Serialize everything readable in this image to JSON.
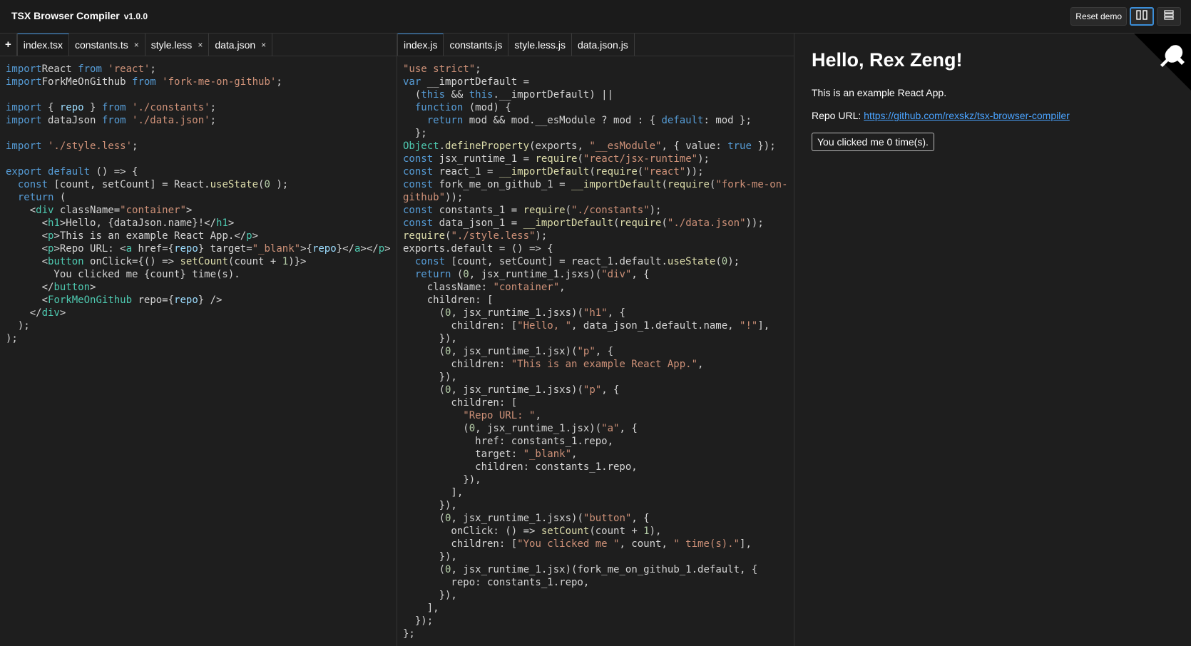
{
  "app": {
    "title": "TSX Browser Compiler",
    "version": "v1.0.0"
  },
  "toolbar": {
    "reset_label": "Reset demo"
  },
  "source_tabs": [
    {
      "label": "index.tsx",
      "close": "×"
    },
    {
      "label": "constants.ts",
      "close": "×"
    },
    {
      "label": "style.less",
      "close": "×"
    },
    {
      "label": "data.json",
      "close": "×"
    }
  ],
  "add_tab_label": "+",
  "output_tabs": [
    "index.js",
    "constants.js",
    "style.less.js",
    "data.json.js"
  ],
  "source_code": [
    [
      [
        "kw",
        "import"
      ],
      [
        "",
        "React "
      ],
      [
        "kw",
        "from"
      ],
      [
        "str",
        " 'react'"
      ],
      [
        "",
        ";"
      ]
    ],
    [
      [
        "kw",
        "import"
      ],
      [
        "",
        "ForkMeOnGithub "
      ],
      [
        "kw",
        "from"
      ],
      [
        "str",
        " 'fork-me-on-github'"
      ],
      [
        "",
        ";"
      ]
    ],
    [
      [
        "",
        ""
      ]
    ],
    [
      [
        "kw",
        "import"
      ],
      [
        "",
        " { "
      ],
      [
        "var",
        "repo"
      ],
      [
        "",
        " } "
      ],
      [
        "kw",
        "from"
      ],
      [
        "str",
        " './constants'"
      ],
      [
        "",
        ";"
      ]
    ],
    [
      [
        "kw",
        "import"
      ],
      [
        "",
        " dataJson "
      ],
      [
        "kw",
        "from"
      ],
      [
        "str",
        " './data.json'"
      ],
      [
        "",
        ";"
      ]
    ],
    [
      [
        "",
        ""
      ]
    ],
    [
      [
        "kw",
        "import"
      ],
      [
        "str",
        " './style.less'"
      ],
      [
        "",
        ";"
      ]
    ],
    [
      [
        "",
        ""
      ]
    ],
    [
      [
        "kw",
        "export"
      ],
      [
        "",
        " "
      ],
      [
        "kw",
        "default"
      ],
      [
        "",
        " () => {"
      ]
    ],
    [
      [
        "",
        "  "
      ],
      [
        "kw",
        "const"
      ],
      [
        "",
        " [count, setCount] = React."
      ],
      [
        "fn",
        "useState"
      ],
      [
        "",
        "("
      ],
      [
        "num",
        "0"
      ],
      [
        "",
        " );"
      ]
    ],
    [
      [
        "",
        "  "
      ],
      [
        "kw",
        "return"
      ],
      [
        "",
        " ("
      ]
    ],
    [
      [
        "",
        "    <"
      ],
      [
        "tag",
        "div"
      ],
      [
        "",
        " className="
      ],
      [
        "str",
        "\"container\""
      ],
      [
        "",
        ">"
      ]
    ],
    [
      [
        "",
        "      <"
      ],
      [
        "tag",
        "h1"
      ],
      [
        "",
        ">Hello, {dataJson.name}!</"
      ],
      [
        "tag",
        "h1"
      ],
      [
        "",
        ">"
      ]
    ],
    [
      [
        "",
        "      <"
      ],
      [
        "tag",
        "p"
      ],
      [
        "",
        ">This is an example React App.</"
      ],
      [
        "tag",
        "p"
      ],
      [
        "",
        ">"
      ]
    ],
    [
      [
        "",
        "      <"
      ],
      [
        "tag",
        "p"
      ],
      [
        "",
        ">Repo URL: <"
      ],
      [
        "tag",
        "a"
      ],
      [
        "",
        " href={"
      ],
      [
        "var",
        "repo"
      ],
      [
        "",
        "} target="
      ],
      [
        "str",
        "\"_blank\""
      ],
      [
        "",
        ">{"
      ],
      [
        "var",
        "repo"
      ],
      [
        "",
        "}</"
      ],
      [
        "tag",
        "a"
      ],
      [
        "",
        "></"
      ],
      [
        "tag",
        "p"
      ],
      [
        "",
        ">"
      ]
    ],
    [
      [
        "",
        "      <"
      ],
      [
        "tag",
        "button"
      ],
      [
        "",
        " onClick={() => "
      ],
      [
        "fn",
        "setCount"
      ],
      [
        "",
        "(count + "
      ],
      [
        "num",
        "1"
      ],
      [
        "",
        ")}>"
      ]
    ],
    [
      [
        "",
        "        You clicked me {count} time(s)."
      ]
    ],
    [
      [
        "",
        "      </"
      ],
      [
        "tag",
        "button"
      ],
      [
        "",
        ">"
      ]
    ],
    [
      [
        "",
        "      <"
      ],
      [
        "tag",
        "ForkMeOnGithub"
      ],
      [
        "",
        " repo={"
      ],
      [
        "var",
        "repo"
      ],
      [
        "",
        "} />"
      ]
    ],
    [
      [
        "",
        "    </"
      ],
      [
        "tag",
        "div"
      ],
      [
        "",
        ">"
      ]
    ],
    [
      [
        "",
        "  );"
      ]
    ],
    [
      [
        "",
        ");"
      ]
    ]
  ],
  "output_code": [
    [
      [
        "str",
        "\"use strict\""
      ],
      [
        "",
        ";"
      ]
    ],
    [
      [
        "kw",
        "var"
      ],
      [
        "",
        " __importDefault ="
      ]
    ],
    [
      [
        "",
        "  ("
      ],
      [
        "kw",
        "this"
      ],
      [
        "",
        " && "
      ],
      [
        "kw",
        "this"
      ],
      [
        "",
        ".__importDefault) ||"
      ]
    ],
    [
      [
        "",
        "  "
      ],
      [
        "kw",
        "function"
      ],
      [
        "",
        " (mod) {"
      ]
    ],
    [
      [
        "",
        "    "
      ],
      [
        "kw",
        "return"
      ],
      [
        "",
        " mod && mod.__esModule ? mod : { "
      ],
      [
        "kw",
        "default"
      ],
      [
        "",
        ": mod };"
      ]
    ],
    [
      [
        "",
        "  };"
      ]
    ],
    [
      [
        "tag",
        "Object"
      ],
      [
        "",
        "."
      ],
      [
        "fn",
        "defineProperty"
      ],
      [
        "",
        "(exports, "
      ],
      [
        "str",
        "\"__esModule\""
      ],
      [
        "",
        ", { value: "
      ],
      [
        "kw",
        "true"
      ],
      [
        "",
        " });"
      ]
    ],
    [
      [
        "kw",
        "const"
      ],
      [
        "",
        " jsx_runtime_1 = "
      ],
      [
        "fn",
        "require"
      ],
      [
        "",
        "("
      ],
      [
        "str",
        "\"react/jsx-runtime\""
      ],
      [
        "",
        ");"
      ]
    ],
    [
      [
        "kw",
        "const"
      ],
      [
        "",
        " react_1 = "
      ],
      [
        "fn",
        "__importDefault"
      ],
      [
        "",
        "("
      ],
      [
        "fn",
        "require"
      ],
      [
        "",
        "("
      ],
      [
        "str",
        "\"react\""
      ],
      [
        "",
        "));"
      ]
    ],
    [
      [
        "kw",
        "const"
      ],
      [
        "",
        " fork_me_on_github_1 = "
      ],
      [
        "fn",
        "__importDefault"
      ],
      [
        "",
        "("
      ],
      [
        "fn",
        "require"
      ],
      [
        "",
        "("
      ],
      [
        "str",
        "\"fork-me-on-"
      ]
    ],
    [
      [
        "str",
        "github\""
      ],
      [
        "",
        "));"
      ]
    ],
    [
      [
        "kw",
        "const"
      ],
      [
        "",
        " constants_1 = "
      ],
      [
        "fn",
        "require"
      ],
      [
        "",
        "("
      ],
      [
        "str",
        "\"./constants\""
      ],
      [
        "",
        ");"
      ]
    ],
    [
      [
        "kw",
        "const"
      ],
      [
        "",
        " data_json_1 = "
      ],
      [
        "fn",
        "__importDefault"
      ],
      [
        "",
        "("
      ],
      [
        "fn",
        "require"
      ],
      [
        "",
        "("
      ],
      [
        "str",
        "\"./data.json\""
      ],
      [
        "",
        "));"
      ]
    ],
    [
      [
        "fn",
        "require"
      ],
      [
        "",
        "("
      ],
      [
        "str",
        "\"./style.less\""
      ],
      [
        "",
        ");"
      ]
    ],
    [
      [
        "",
        "exports.default = () => {"
      ]
    ],
    [
      [
        "",
        "  "
      ],
      [
        "kw",
        "const"
      ],
      [
        "",
        " [count, setCount] = react_1.default."
      ],
      [
        "fn",
        "useState"
      ],
      [
        "",
        "("
      ],
      [
        "num",
        "0"
      ],
      [
        "",
        ");"
      ]
    ],
    [
      [
        "",
        "  "
      ],
      [
        "kw",
        "return"
      ],
      [
        "",
        " ("
      ],
      [
        "num",
        "0"
      ],
      [
        "",
        ", jsx_runtime_1.jsxs)("
      ],
      [
        "str",
        "\"div\""
      ],
      [
        "",
        ", {"
      ]
    ],
    [
      [
        "",
        "    className: "
      ],
      [
        "str",
        "\"container\""
      ],
      [
        "",
        ","
      ]
    ],
    [
      [
        "",
        "    children: ["
      ]
    ],
    [
      [
        "",
        "      ("
      ],
      [
        "num",
        "0"
      ],
      [
        "",
        ", jsx_runtime_1.jsxs)("
      ],
      [
        "str",
        "\"h1\""
      ],
      [
        "",
        ", {"
      ]
    ],
    [
      [
        "",
        "        children: ["
      ],
      [
        "str",
        "\"Hello, \""
      ],
      [
        "",
        ", data_json_1.default.name, "
      ],
      [
        "str",
        "\"!\""
      ],
      [
        "",
        "],"
      ]
    ],
    [
      [
        "",
        "      }),"
      ]
    ],
    [
      [
        "",
        "      ("
      ],
      [
        "num",
        "0"
      ],
      [
        "",
        ", jsx_runtime_1.jsx)("
      ],
      [
        "str",
        "\"p\""
      ],
      [
        "",
        ", {"
      ]
    ],
    [
      [
        "",
        "        children: "
      ],
      [
        "str",
        "\"This is an example React App.\""
      ],
      [
        "",
        ","
      ]
    ],
    [
      [
        "",
        "      }),"
      ]
    ],
    [
      [
        "",
        "      ("
      ],
      [
        "num",
        "0"
      ],
      [
        "",
        ", jsx_runtime_1.jsxs)("
      ],
      [
        "str",
        "\"p\""
      ],
      [
        "",
        ", {"
      ]
    ],
    [
      [
        "",
        "        children: ["
      ]
    ],
    [
      [
        "",
        "          "
      ],
      [
        "str",
        "\"Repo URL: \""
      ],
      [
        "",
        ","
      ]
    ],
    [
      [
        "",
        "          ("
      ],
      [
        "num",
        "0"
      ],
      [
        "",
        ", jsx_runtime_1.jsx)("
      ],
      [
        "str",
        "\"a\""
      ],
      [
        "",
        ", {"
      ]
    ],
    [
      [
        "",
        "            href: constants_1.repo,"
      ]
    ],
    [
      [
        "",
        "            target: "
      ],
      [
        "str",
        "\"_blank\""
      ],
      [
        "",
        ","
      ]
    ],
    [
      [
        "",
        "            children: constants_1.repo,"
      ]
    ],
    [
      [
        "",
        "          }),"
      ]
    ],
    [
      [
        "",
        "        ],"
      ]
    ],
    [
      [
        "",
        "      }),"
      ]
    ],
    [
      [
        "",
        "      ("
      ],
      [
        "num",
        "0"
      ],
      [
        "",
        ", jsx_runtime_1.jsxs)("
      ],
      [
        "str",
        "\"button\""
      ],
      [
        "",
        ", {"
      ]
    ],
    [
      [
        "",
        "        onClick: () => "
      ],
      [
        "fn",
        "setCount"
      ],
      [
        "",
        "(count + "
      ],
      [
        "num",
        "1"
      ],
      [
        "",
        "),"
      ]
    ],
    [
      [
        "",
        "        children: ["
      ],
      [
        "str",
        "\"You clicked me \""
      ],
      [
        "",
        ", count, "
      ],
      [
        "str",
        "\" time(s).\""
      ],
      [
        "",
        "],"
      ]
    ],
    [
      [
        "",
        "      }),"
      ]
    ],
    [
      [
        "",
        "      ("
      ],
      [
        "num",
        "0"
      ],
      [
        "",
        ", jsx_runtime_1.jsx)(fork_me_on_github_1.default, {"
      ]
    ],
    [
      [
        "",
        "        repo: constants_1.repo,"
      ]
    ],
    [
      [
        "",
        "      }),"
      ]
    ],
    [
      [
        "",
        "    ],"
      ]
    ],
    [
      [
        "",
        "  });"
      ]
    ],
    [
      [
        "",
        "};"
      ]
    ]
  ],
  "preview": {
    "heading": "Hello, Rex Zeng!",
    "intro": "This is an example React App.",
    "repo_label": "Repo URL: ",
    "repo_url": "https://github.com/rexskz/tsx-browser-compiler",
    "button_label": "You clicked me 0 time(s)."
  },
  "icons": {
    "layout_split": "columns-icon",
    "layout_stack": "rows-icon",
    "fork": "github-octocat-icon"
  },
  "colors": {
    "accent": "#3b8ed8",
    "link": "#4aa3ff",
    "background": "#1e1e1e"
  }
}
